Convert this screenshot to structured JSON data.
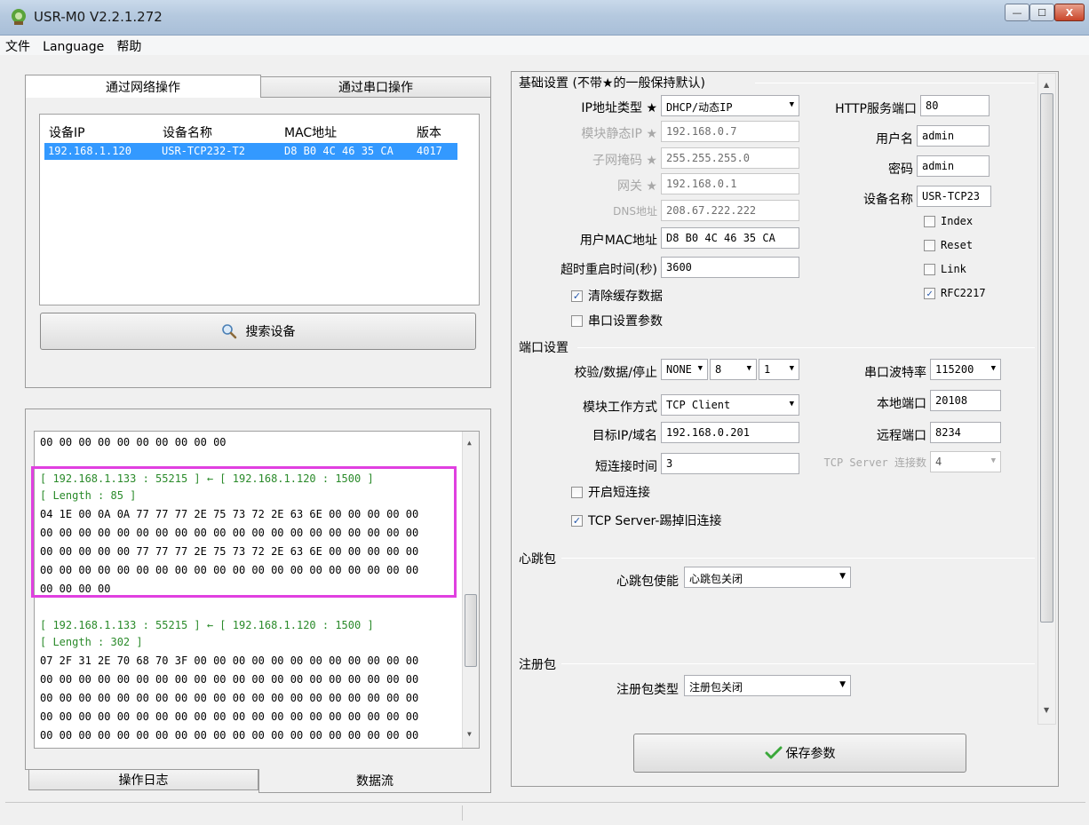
{
  "window": {
    "title": "USR-M0 V2.2.1.272",
    "minimize": "—",
    "maximize": "☐",
    "close": "X"
  },
  "menu": [
    "文件",
    "Language",
    "帮助"
  ],
  "left_tabs": {
    "network": "通过网络操作",
    "serial": "通过串口操作"
  },
  "device_table": {
    "headers": [
      "设备IP",
      "设备名称",
      "MAC地址",
      "版本"
    ],
    "rows": [
      {
        "ip": "192.168.1.120",
        "name": "USR-TCP232-T2",
        "mac": "D8 B0 4C 46 35 CA",
        "version": "4017"
      }
    ]
  },
  "search_button": "搜索设备",
  "log_lines": [
    {
      "text": "00 00 00 00 00 00 00 00 00 00",
      "color": "black"
    },
    {
      "text": "[ 192.168.1.133 : 55215 ] ← [ 192.168.1.120 : 1500 ]",
      "color": "green"
    },
    {
      "text": "[ Length : 85 ]",
      "color": "green"
    },
    {
      "text": "04 1E 00 0A 0A 77 77 77 2E 75 73 72 2E 63 6E 00 00 00 00 00",
      "color": "black"
    },
    {
      "text": "00 00 00 00 00 00 00 00 00 00 00 00 00 00 00 00 00 00 00 00",
      "color": "black"
    },
    {
      "text": "00 00 00 00 00 77 77 77 2E 75 73 72 2E 63 6E 00 00 00 00 00",
      "color": "black"
    },
    {
      "text": "00 00 00 00 00 00 00 00 00 00 00 00 00 00 00 00 00 00 00 00",
      "color": "black"
    },
    {
      "text": "00 00 00 00",
      "color": "black"
    },
    {
      "text": "[ 192.168.1.133 : 55215 ] ← [ 192.168.1.120 : 1500 ]",
      "color": "green"
    },
    {
      "text": "[ Length : 302 ]",
      "color": "green"
    },
    {
      "text": "07 2F 31 2E 70 68 70 3F 00 00 00 00 00 00 00 00 00 00 00 00",
      "color": "black"
    },
    {
      "text": "00 00 00 00 00 00 00 00 00 00 00 00 00 00 00 00 00 00 00 00",
      "color": "black"
    },
    {
      "text": "00 00 00 00 00 00 00 00 00 00 00 00 00 00 00 00 00 00 00 00",
      "color": "black"
    },
    {
      "text": "00 00 00 00 00 00 00 00 00 00 00 00 00 00 00 00 00 00 00 00",
      "color": "black"
    },
    {
      "text": "00 00 00 00 00 00 00 00 00 00 00 00 00 00 00 00 00 00 00 00",
      "color": "black"
    }
  ],
  "bottom_tabs": {
    "log": "操作日志",
    "stream": "数据流"
  },
  "basic": {
    "title": "基础设置 (不带★的一般保持默认)",
    "ip_type_label": "IP地址类型 ★",
    "ip_type_value": "DHCP/动态IP",
    "static_ip_label": "模块静态IP ★",
    "static_ip_value": "192.168.0.7",
    "mask_label": "子网掩码 ★",
    "mask_value": "255.255.255.0",
    "gateway_label": "网关 ★",
    "gateway_value": "192.168.0.1",
    "dns_label": "DNS地址",
    "dns_value": "208.67.222.222",
    "mac_label": "用户MAC地址",
    "mac_value": "D8 B0 4C 46 35 CA",
    "timeout_label": "超时重启时间(秒)",
    "timeout_value": "3600",
    "clear_cache": {
      "label": "清除缓存数据",
      "checked": true
    },
    "serial_param": {
      "label": "串口设置参数",
      "checked": false
    },
    "http_port_label": "HTTP服务端口",
    "http_port_value": "80",
    "username_label": "用户名",
    "username_value": "admin",
    "password_label": "密码",
    "password_value": "admin",
    "device_name_label": "设备名称",
    "device_name_value": "USR-TCP23",
    "index": {
      "label": "Index",
      "checked": false
    },
    "reset": {
      "label": "Reset",
      "checked": false
    },
    "link": {
      "label": "Link",
      "checked": false
    },
    "rfc2217": {
      "label": "RFC2217",
      "checked": true
    }
  },
  "port": {
    "title": "端口设置",
    "parity_label": "校验/数据/停止",
    "parity_value": "NONE",
    "data_value": "8",
    "stop_value": "1",
    "baud_label": "串口波特率",
    "baud_value": "115200",
    "mode_label": "模块工作方式",
    "mode_value": "TCP Client",
    "local_port_label": "本地端口",
    "local_port_value": "20108",
    "target_label": "目标IP/域名",
    "target_value": "192.168.0.201",
    "remote_port_label": "远程端口",
    "remote_port_value": "8234",
    "short_time_label": "短连接时间",
    "short_time_value": "3",
    "server_conn_label": "TCP Server 连接数",
    "server_conn_value": "4",
    "short_conn": {
      "label": "开启短连接",
      "checked": false
    },
    "kick_old": {
      "label": "TCP Server-踢掉旧连接",
      "checked": true
    }
  },
  "heartbeat": {
    "title": "心跳包",
    "label": "心跳包使能",
    "value": "心跳包关闭"
  },
  "register": {
    "title": "注册包",
    "label": "注册包类型",
    "value": "注册包关闭"
  },
  "save_button": "保存参数",
  "colors": {
    "selection": "#3399ff",
    "highlight": "#e040e0",
    "green_text": "#2a8a2a"
  }
}
